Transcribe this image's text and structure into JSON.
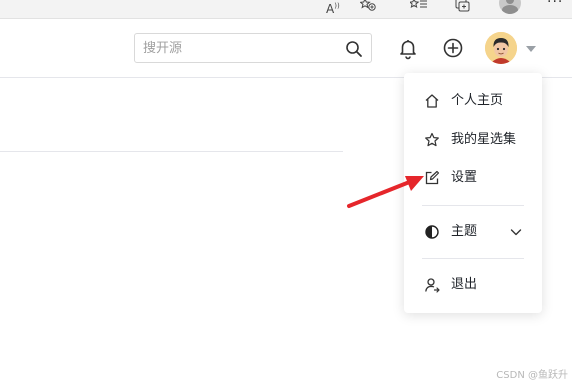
{
  "browser": {
    "read_aloud_label": "A",
    "read_aloud_sup": "))"
  },
  "header": {
    "search": {
      "placeholder": "搜开源",
      "value": ""
    }
  },
  "user_menu": {
    "items": [
      {
        "label": "个人主页",
        "icon": "home-icon"
      },
      {
        "label": "我的星选集",
        "icon": "star-icon"
      },
      {
        "label": "设置",
        "icon": "edit-icon"
      },
      {
        "label": "主题",
        "icon": "theme-icon"
      },
      {
        "label": "退出",
        "icon": "logout-icon"
      }
    ]
  },
  "annotation": {
    "arrow_color": "#e5262b"
  },
  "footer": {
    "watermark": "CSDN @鱼跃升"
  }
}
